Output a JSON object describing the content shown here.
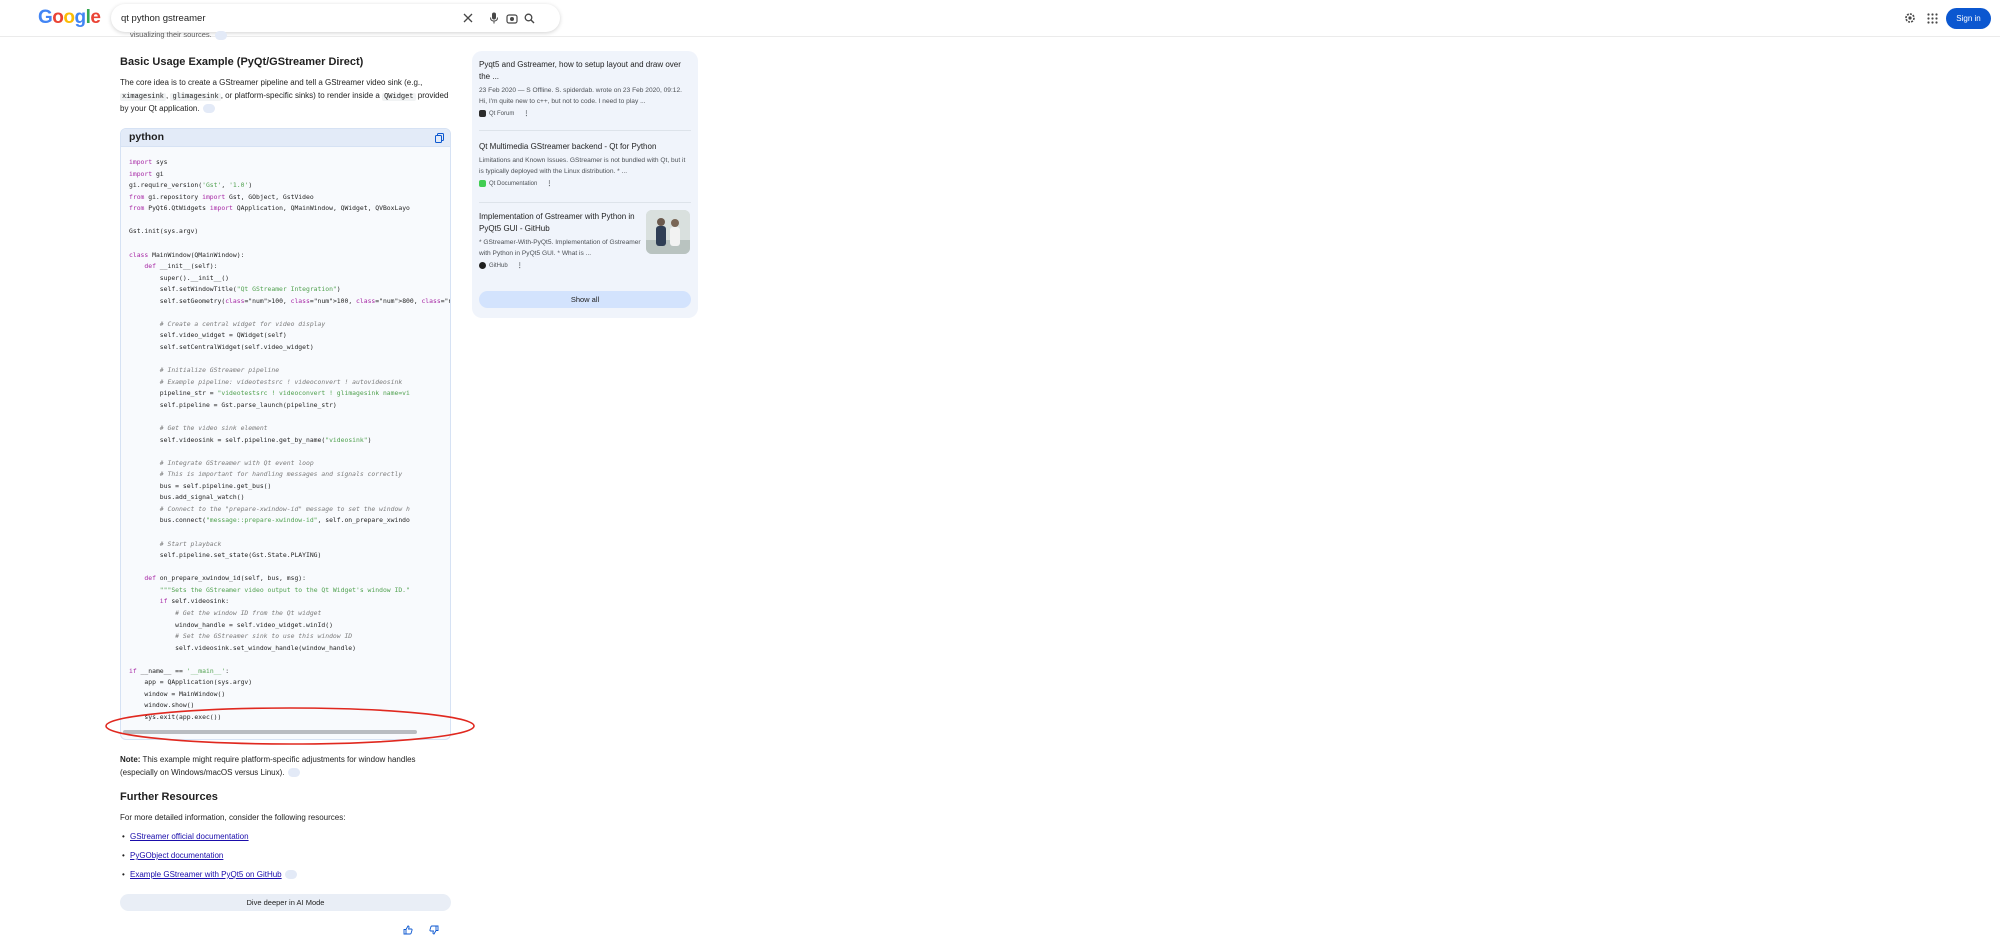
{
  "header": {
    "logo": "Google",
    "search_value": "qt python gstreamer",
    "sign_in": "Sign in"
  },
  "main": {
    "faded_text": "visualizing their sources.",
    "heading": "Basic Usage Example (PyQt/GStreamer Direct)",
    "intro": {
      "p1": "The core idea is to create a GStreamer pipeline and tell a GStreamer video sink (e.g.,",
      "code1": "ximagesink",
      "sep1": ",",
      "code2": "glimagesink",
      "p2": ", or platform-specific sinks) to render inside a",
      "code3": "QWidget",
      "p3": "provided by your Qt application."
    },
    "code_block": {
      "language": "python",
      "lines": [
        "import sys",
        "import gi",
        "gi.require_version('Gst', '1.0')",
        "from gi.repository import Gst, GObject, GstVideo",
        "from PyQt6.QtWidgets import QApplication, QMainWindow, QWidget, QVBoxLayo",
        "",
        "Gst.init(sys.argv)",
        "",
        "class MainWindow(QMainWindow):",
        "    def __init__(self):",
        "        super().__init__()",
        "        self.setWindowTitle(\"Qt GStreamer Integration\")",
        "        self.setGeometry(100, 100, 800, 600)",
        "",
        "        # Create a central widget for video display",
        "        self.video_widget = QWidget(self)",
        "        self.setCentralWidget(self.video_widget)",
        "",
        "        # Initialize GStreamer pipeline",
        "        # Example pipeline: videotestsrc ! videoconvert ! autovideosink",
        "        pipeline_str = \"videotestsrc ! videoconvert ! glimagesink name=vi",
        "        self.pipeline = Gst.parse_launch(pipeline_str)",
        "",
        "        # Get the video sink element",
        "        self.videosink = self.pipeline.get_by_name(\"videosink\")",
        "",
        "        # Integrate GStreamer with Qt event loop",
        "        # This is important for handling messages and signals correctly",
        "        bus = self.pipeline.get_bus()",
        "        bus.add_signal_watch()",
        "        # Connect to the \"prepare-xwindow-id\" message to set the window h",
        "        bus.connect(\"message::prepare-xwindow-id\", self.on_prepare_xwindo",
        "",
        "        # Start playback",
        "        self.pipeline.set_state(Gst.State.PLAYING)",
        "",
        "    def on_prepare_xwindow_id(self, bus, msg):",
        "        \"\"\"Sets the GStreamer video output to the Qt Widget's window ID.\"",
        "        if self.videosink:",
        "            # Get the window ID from the Qt widget",
        "            window_handle = self.video_widget.winId()",
        "            # Set the GStreamer sink to use this window ID",
        "            self.videosink.set_window_handle(window_handle)",
        "",
        "if __name__ == '__main__':",
        "    app = QApplication(sys.argv)",
        "    window = MainWindow()",
        "    window.show()",
        "    sys.exit(app.exec())"
      ]
    },
    "note_label": "Note:",
    "note_text": "This example might require platform-specific adjustments for window handles (especially on Windows/macOS versus Linux).",
    "further_heading": "Further Resources",
    "further_intro": "For more detailed information, consider the following resources:",
    "resources": [
      "GStreamer official documentation",
      "PyGObject documentation",
      "Example GStreamer with PyQt5 on GitHub"
    ],
    "dive_button": "Dive deeper in AI Mode"
  },
  "side": {
    "cards": [
      {
        "title": "Pyqt5 and Gstreamer, how to setup layout and draw over the ...",
        "snippet": "23 Feb 2020 — S Offline. S. spiderdab. wrote on 23 Feb 2020, 09:12. Hi, I'm quite new to c++, but not to code. I need to play ...",
        "source": "Qt Forum"
      },
      {
        "title": "Qt Multimedia GStreamer backend - Qt for Python",
        "snippet": "Limitations and Known Issues. GStreamer is not bundled with Qt, but it is typically deployed with the Linux distribution. * ...",
        "source": "Qt Documentation"
      },
      {
        "title": "Implementation of Gstreamer with Python in PyQt5 GUI - GitHub",
        "snippet": "* GStreamer-With-PyQt5. Implementation of Gstreamer with Python in PyQt5 GUI. * What is ...",
        "source": "GitHub"
      }
    ],
    "show_all": "Show all"
  },
  "colors": {
    "accent": "#0b57d0",
    "link": "#1a0dab",
    "annotation": "#e0281f"
  }
}
